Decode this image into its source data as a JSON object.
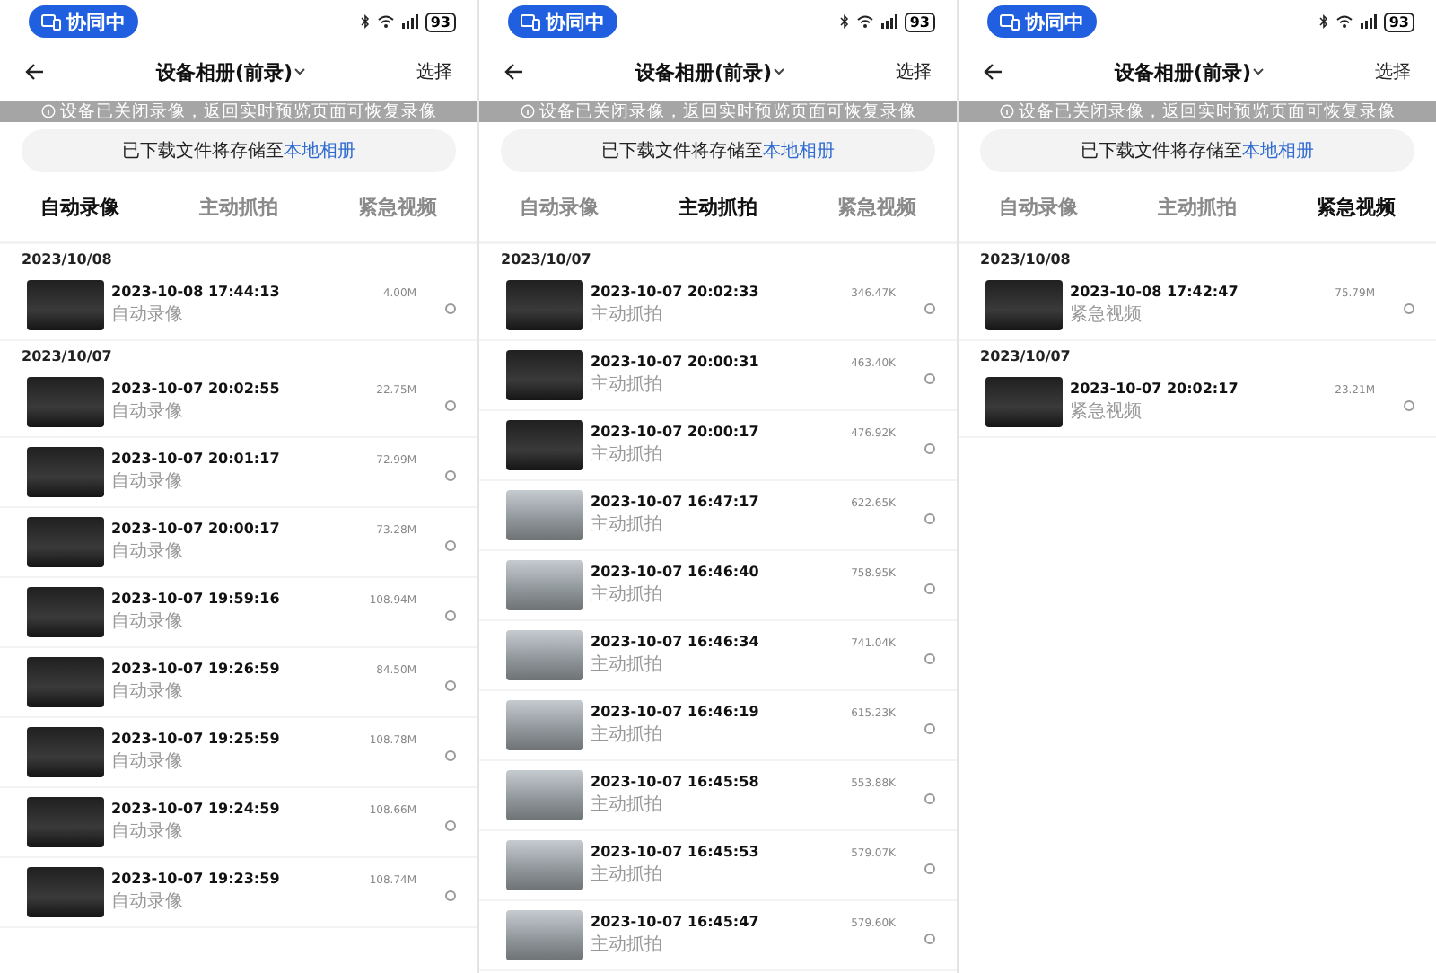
{
  "screens": [
    {
      "status": {
        "badge": "协同中",
        "battery": "93"
      },
      "header": {
        "title": "设备相册(前录)",
        "action": "选择"
      },
      "notice": "设备已关闭录像，返回实时预览页面可恢复录像",
      "banner": {
        "text": "已下载文件将存储至",
        "link": "本地相册"
      },
      "tabs": [
        {
          "label": "自动录像",
          "selected": true
        },
        {
          "label": "主动抓拍",
          "selected": false
        },
        {
          "label": "紧急视频",
          "selected": false
        }
      ],
      "groups": [
        {
          "date": "2023/10/08",
          "items": [
            {
              "title": "2023-10-08 17:44:13",
              "type": "自动录像",
              "size": "4.00M",
              "kind": "night",
              "checked": false
            }
          ]
        },
        {
          "date": "2023/10/07",
          "items": [
            {
              "title": "2023-10-07 20:02:55",
              "type": "自动录像",
              "size": "22.75M",
              "kind": "night",
              "checked": false
            },
            {
              "title": "2023-10-07 20:01:17",
              "type": "自动录像",
              "size": "72.99M",
              "kind": "night",
              "checked": false
            },
            {
              "title": "2023-10-07 20:00:17",
              "type": "自动录像",
              "size": "73.28M",
              "kind": "night",
              "checked": false
            },
            {
              "title": "2023-10-07 19:59:16",
              "type": "自动录像",
              "size": "108.94M",
              "kind": "night",
              "checked": false
            },
            {
              "title": "2023-10-07 19:26:59",
              "type": "自动录像",
              "size": "84.50M",
              "kind": "night",
              "checked": false
            },
            {
              "title": "2023-10-07 19:25:59",
              "type": "自动录像",
              "size": "108.78M",
              "kind": "night",
              "checked": false
            },
            {
              "title": "2023-10-07 19:24:59",
              "type": "自动录像",
              "size": "108.66M",
              "kind": "night",
              "checked": false
            },
            {
              "title": "2023-10-07 19:23:59",
              "type": "自动录像",
              "size": "108.74M",
              "kind": "night",
              "checked": false
            }
          ]
        }
      ]
    },
    {
      "status": {
        "badge": "协同中",
        "battery": "93"
      },
      "header": {
        "title": "设备相册(前录)",
        "action": "选择"
      },
      "notice": "设备已关闭录像，返回实时预览页面可恢复录像",
      "banner": {
        "text": "已下载文件将存储至",
        "link": "本地相册"
      },
      "tabs": [
        {
          "label": "自动录像",
          "selected": false
        },
        {
          "label": "主动抓拍",
          "selected": true
        },
        {
          "label": "紧急视频",
          "selected": false
        }
      ],
      "groups": [
        {
          "date": "2023/10/07",
          "items": [
            {
              "title": "2023-10-07 20:02:33",
              "type": "主动抓拍",
              "size": "346.47K",
              "kind": "night",
              "checked": false
            },
            {
              "title": "2023-10-07 20:00:31",
              "type": "主动抓拍",
              "size": "463.40K",
              "kind": "night",
              "checked": false
            },
            {
              "title": "2023-10-07 20:00:17",
              "type": "主动抓拍",
              "size": "476.92K",
              "kind": "night",
              "checked": false
            },
            {
              "title": "2023-10-07 16:47:17",
              "type": "主动抓拍",
              "size": "622.65K",
              "kind": "day",
              "checked": false
            },
            {
              "title": "2023-10-07 16:46:40",
              "type": "主动抓拍",
              "size": "758.95K",
              "kind": "day",
              "checked": false
            },
            {
              "title": "2023-10-07 16:46:34",
              "type": "主动抓拍",
              "size": "741.04K",
              "kind": "day",
              "checked": false
            },
            {
              "title": "2023-10-07 16:46:19",
              "type": "主动抓拍",
              "size": "615.23K",
              "kind": "day",
              "checked": false
            },
            {
              "title": "2023-10-07 16:45:58",
              "type": "主动抓拍",
              "size": "553.88K",
              "kind": "day",
              "checked": false
            },
            {
              "title": "2023-10-07 16:45:53",
              "type": "主动抓拍",
              "size": "579.07K",
              "kind": "day",
              "checked": false
            },
            {
              "title": "2023-10-07 16:45:47",
              "type": "主动抓拍",
              "size": "579.60K",
              "kind": "day",
              "checked": false
            }
          ]
        }
      ]
    },
    {
      "status": {
        "badge": "协同中",
        "battery": "93"
      },
      "header": {
        "title": "设备相册(前录)",
        "action": "选择"
      },
      "notice": "设备已关闭录像，返回实时预览页面可恢复录像",
      "banner": {
        "text": "已下载文件将存储至",
        "link": "本地相册"
      },
      "tabs": [
        {
          "label": "自动录像",
          "selected": false
        },
        {
          "label": "主动抓拍",
          "selected": false
        },
        {
          "label": "紧急视频",
          "selected": true
        }
      ],
      "groups": [
        {
          "date": "2023/10/08",
          "items": [
            {
              "title": "2023-10-08 17:42:47",
              "type": "紧急视频",
              "size": "75.79M",
              "kind": "night",
              "checked": false
            }
          ]
        },
        {
          "date": "2023/10/07",
          "items": [
            {
              "title": "2023-10-07 20:02:17",
              "type": "紧急视频",
              "size": "23.21M",
              "kind": "night",
              "checked": false
            }
          ]
        }
      ]
    }
  ]
}
